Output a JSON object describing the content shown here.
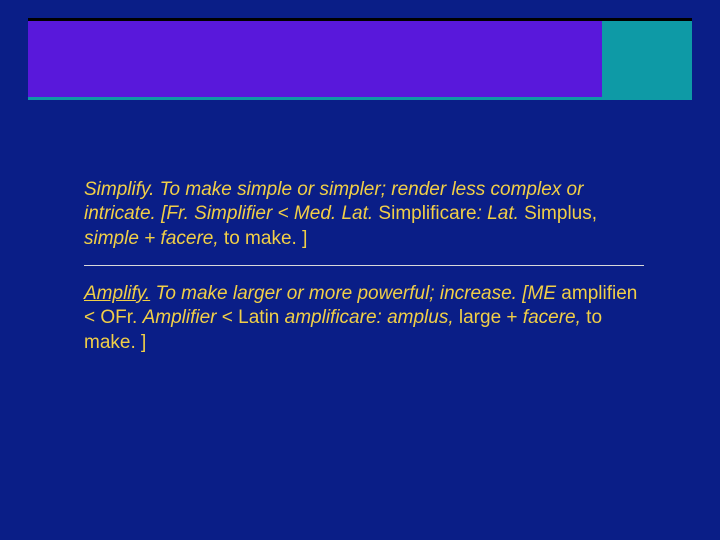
{
  "colors": {
    "background": "#0a1e87",
    "header_bar": "#5918db",
    "header_square": "#0e9aa6",
    "text": "#f1cf47"
  },
  "entry1": {
    "term": "Simplify.",
    "seg1": "  To make simple or simpler; render less complex or intricate.  [Fr. Simplifier < Med. Lat.",
    "seg2": " Simplificare",
    "seg3": ": Lat.",
    "seg4": " Simplus, ",
    "seg5": "simple + facere,",
    "seg6": "  to make. ]"
  },
  "entry2": {
    "term": "Amplify.",
    "seg1": "  To make larger or more powerful; increase.  [ME",
    "seg2": " amplifien < OFr. ",
    "seg3": "Amplifier ",
    "seg4": "< Latin ",
    "seg5": "amplificare: amplus,",
    "seg6": " large + ",
    "seg7": "facere,",
    "seg8": "  to make. ]"
  }
}
